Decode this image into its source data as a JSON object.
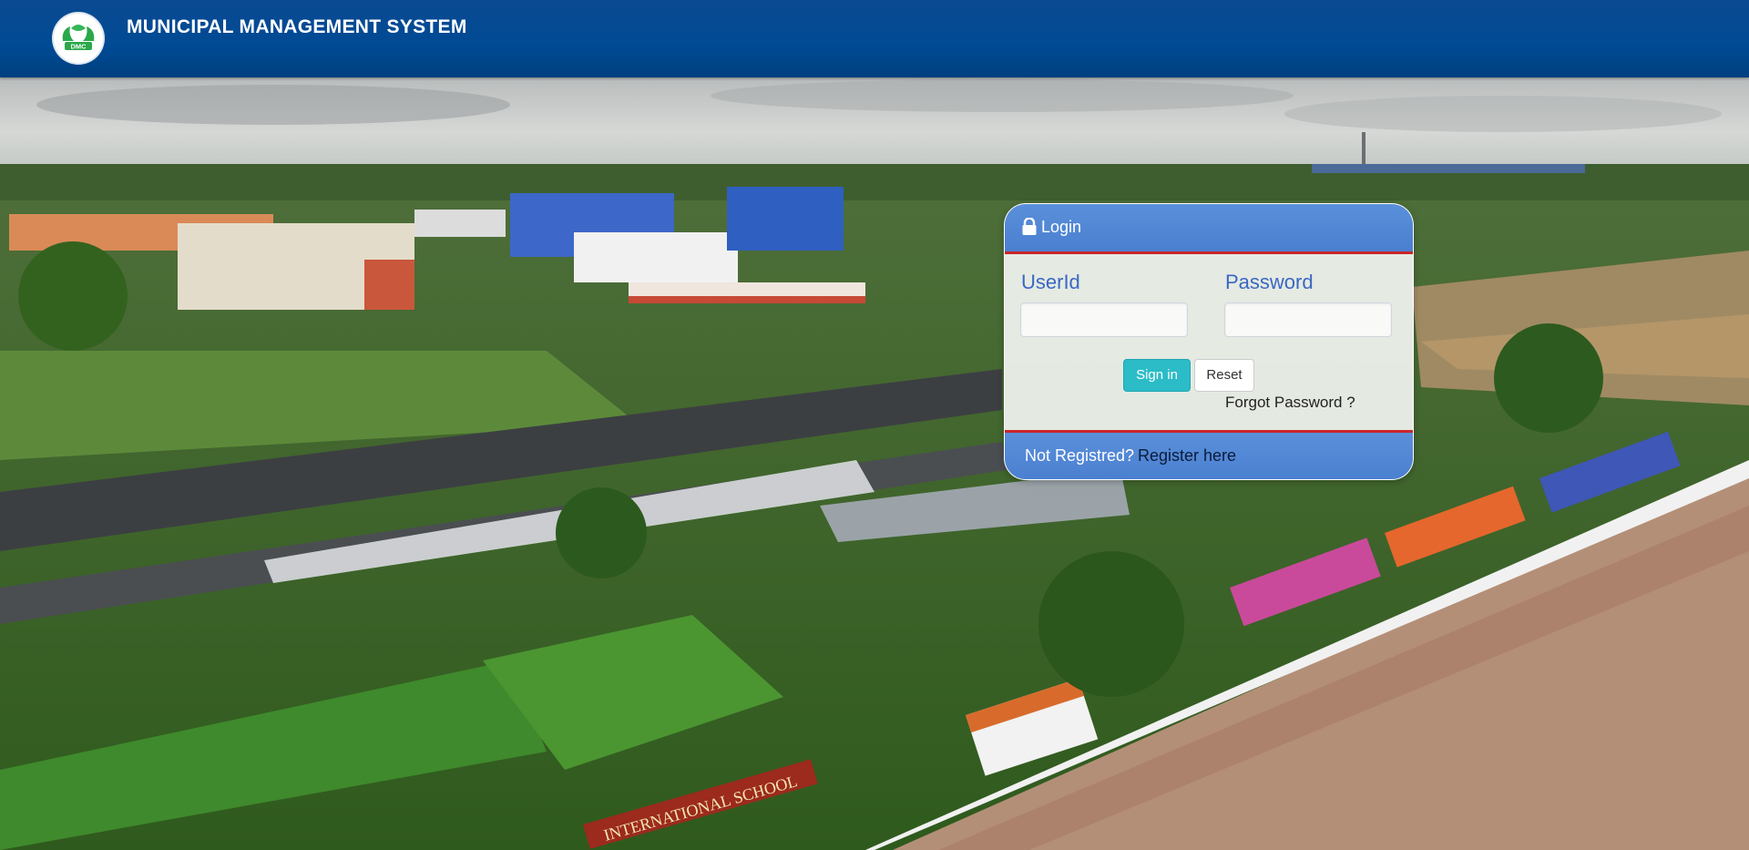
{
  "header": {
    "title": "MUNICIPAL MANAGEMENT SYSTEM",
    "logo_icon": "municipal-logo-icon",
    "logo_text": "DMC",
    "background_color": "#004a94"
  },
  "background": {
    "icon": "city-landscape-photo",
    "signboard_text": "INTERNATIONAL SCHOOL"
  },
  "login": {
    "title": "Login",
    "title_icon": "lock-icon",
    "userid_label": "UserId",
    "userid_value": "",
    "password_label": "Password",
    "password_value": "",
    "signin_label": "Sign in",
    "reset_label": "Reset",
    "forgot_label": "Forgot Password ?",
    "not_registered_text": "Not Registred?",
    "register_label": "Register here",
    "accent_color": "#4a7fd0",
    "divider_color": "#c9262b",
    "signin_color": "#2bbcc8"
  }
}
